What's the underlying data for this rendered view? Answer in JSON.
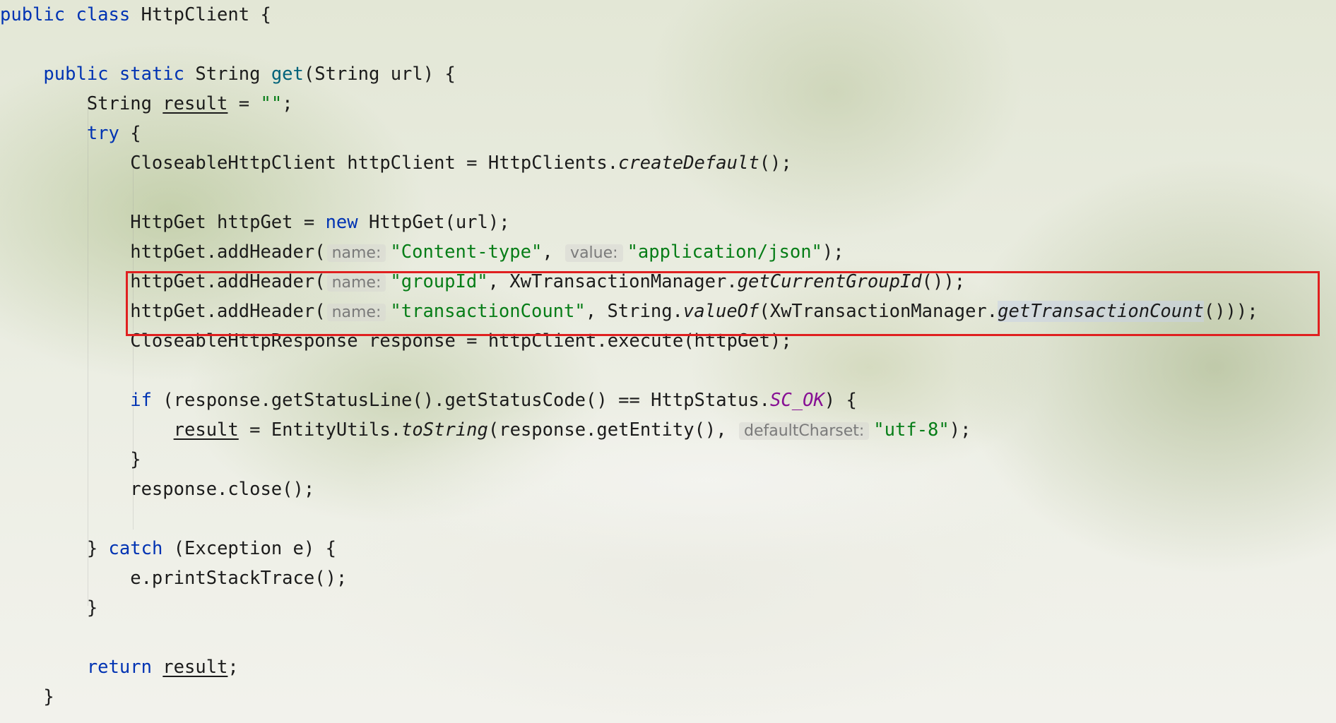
{
  "code": {
    "lines": [
      "public class HttpClient {",
      "",
      "    public static String get(String url) {",
      "        String result = \"\";",
      "        try {",
      "            CloseableHttpClient httpClient = HttpClients.createDefault();",
      "",
      "            HttpGet httpGet = new HttpGet(url);",
      "            httpGet.addHeader( name: \"Content-type\",  value: \"application/json\");",
      "            httpGet.addHeader( name: \"groupId\", XwTransactionManager.getCurrentGroupId());",
      "            httpGet.addHeader( name: \"transactionCount\", String.valueOf(XwTransactionManager.getTransactionCount()));",
      "            CloseableHttpResponse response = httpClient.execute(httpGet);",
      "",
      "            if (response.getStatusLine().getStatusCode() == HttpStatus.SC_OK) {",
      "                result = EntityUtils.toString(response.getEntity(),  defaultCharset: \"utf-8\");",
      "            }",
      "            response.close();",
      "",
      "        } catch (Exception e) {",
      "            e.printStackTrace();",
      "        }",
      "",
      "        return result;",
      "    }"
    ],
    "hints": {
      "name": "name:",
      "value": "value:",
      "default_charset": "defaultCharset:"
    },
    "highlighted_lines": [
      10,
      11
    ]
  },
  "colors": {
    "keyword": "#0033b3",
    "method_decl": "#00627a",
    "string": "#067d17",
    "constant": "#871094",
    "highlight_border": "#e02020"
  }
}
